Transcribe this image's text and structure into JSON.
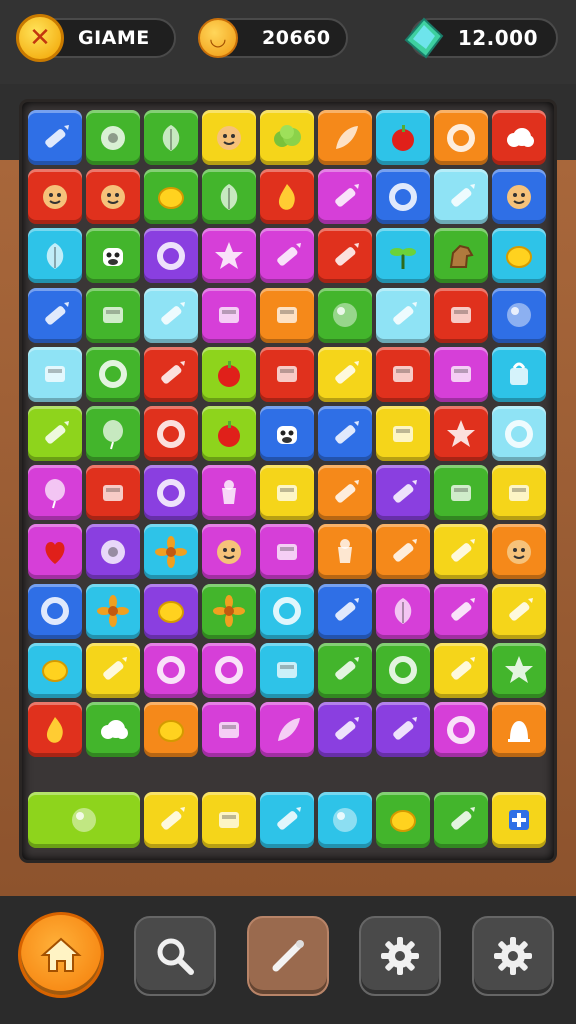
{
  "header": {
    "title": "GIAME",
    "coins": "20660",
    "gems": "12.000"
  },
  "colors": {
    "blue": "#2f6fe6",
    "green": "#43b52c",
    "lime": "#8ed41c",
    "yellow": "#f5d51a",
    "orange": "#f5891a",
    "red": "#e0311d",
    "magenta": "#d63fd8",
    "purple": "#8a3fe0",
    "cyan": "#2ec3e8",
    "pink": "#f04fa8",
    "lightblue": "#8fe3f5"
  },
  "board": {
    "rows": [
      [
        "blue:crayon",
        "green:donut",
        "green:leaf",
        "yellow:face",
        "yellow:bush",
        "orange:feather",
        "cyan:apple",
        "orange:ring",
        "red:cloud"
      ],
      [
        "red:face",
        "red:face",
        "green:lemon",
        "green:leaf",
        "red:flame",
        "magenta:crayon",
        "blue:ring",
        "lightblue:crayon",
        "blue:face"
      ],
      [
        "cyan:leaf",
        "green:cow",
        "purple:ring",
        "magenta:star",
        "magenta:crayon",
        "red:crayon",
        "cyan:plant",
        "green:horse",
        "cyan:lemon"
      ],
      [
        "blue:crayon",
        "green:box",
        "lightblue:crayon",
        "magenta:box",
        "orange:box",
        "green:orb",
        "lightblue:crayon",
        "red:box",
        "blue:orb"
      ],
      [
        "lightblue:box",
        "green:ring",
        "red:crayon",
        "lime:apple",
        "red:box",
        "yellow:crayon",
        "red:box",
        "magenta:box",
        "cyan:bag"
      ],
      [
        "lime:crayon",
        "green:balloon",
        "red:ring",
        "lime:apple",
        "blue:cow",
        "blue:crayon",
        "yellow:box",
        "red:star",
        "lightblue:ring"
      ],
      [
        "magenta:balloon",
        "red:box",
        "purple:ring",
        "magenta:cup",
        "yellow:box",
        "orange:crayon",
        "purple:crayon",
        "green:box",
        "yellow:box"
      ],
      [
        "magenta:heart",
        "purple:donut",
        "cyan:flower",
        "magenta:face",
        "magenta:box",
        "orange:cup",
        "orange:crayon",
        "yellow:crayon",
        "orange:face"
      ],
      [
        "blue:ring",
        "cyan:flower",
        "purple:lemon",
        "green:flower",
        "cyan:ring",
        "blue:crayon",
        "magenta:leaf",
        "magenta:crayon",
        "yellow:crayon"
      ],
      [
        "cyan:lemon",
        "yellow:crayon",
        "magenta:ring",
        "magenta:ring",
        "cyan:box",
        "green:crayon",
        "green:ring",
        "yellow:crayon",
        "green:star"
      ],
      [
        "red:flame",
        "green:cloud",
        "orange:lemon",
        "magenta:box",
        "magenta:feather",
        "purple:crayon",
        "purple:crayon",
        "magenta:ring",
        "orange:bell"
      ]
    ]
  },
  "tray": [
    {
      "color": "lime",
      "icon": "orb",
      "span": 2
    },
    {
      "color": "yellow",
      "icon": "crayon",
      "span": 1
    },
    {
      "color": "yellow",
      "icon": "box",
      "span": 1
    },
    {
      "color": "cyan",
      "icon": "crayon",
      "span": 1
    },
    {
      "color": "cyan",
      "icon": "orb",
      "span": 1
    },
    {
      "color": "green",
      "icon": "lemon",
      "span": 1
    },
    {
      "color": "green",
      "icon": "crayon",
      "span": 1
    },
    {
      "color": "yellow",
      "icon": "plus",
      "span": 1
    }
  ],
  "nav": {
    "items": [
      "home-icon",
      "search-icon",
      "pencil-icon",
      "gear-icon",
      "settings-icon"
    ]
  }
}
